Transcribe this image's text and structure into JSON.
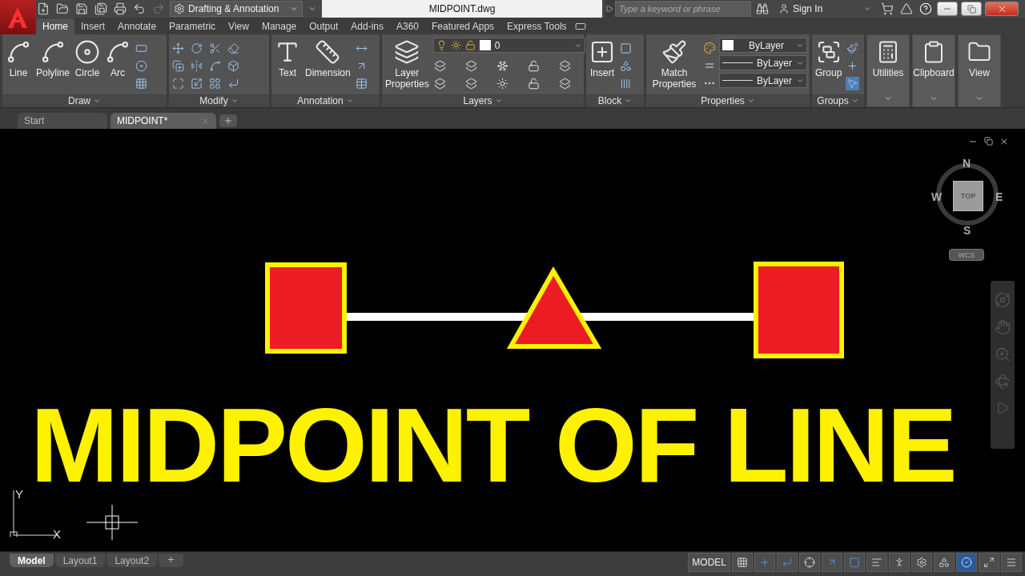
{
  "title_bar": {
    "workspace": "Drafting & Annotation",
    "file_title": "MIDPOINT.dwg",
    "search": {
      "placeholder": "Type a keyword or phrase"
    },
    "sign_in": "Sign In"
  },
  "ribbon_tabs": [
    {
      "label": "Home",
      "selected": true
    },
    {
      "label": "Insert",
      "selected": false
    },
    {
      "label": "Annotate",
      "selected": false
    },
    {
      "label": "Parametric",
      "selected": false
    },
    {
      "label": "View",
      "selected": false
    },
    {
      "label": "Manage",
      "selected": false
    },
    {
      "label": "Output",
      "selected": false
    },
    {
      "label": "Add-ins",
      "selected": false
    },
    {
      "label": "A360",
      "selected": false
    },
    {
      "label": "Featured Apps",
      "selected": false
    },
    {
      "label": "Express Tools",
      "selected": false
    }
  ],
  "panels": [
    {
      "kind": "tools",
      "title": "Draw",
      "tools": [
        "Line",
        "Polyline",
        "Circle",
        "Arc"
      ]
    },
    {
      "kind": "tools",
      "title": "Modify"
    },
    {
      "kind": "tools",
      "title": "Annotation",
      "tools": [
        "Text",
        "Dimension"
      ]
    },
    {
      "kind": "layers",
      "title": "Layers",
      "tools": [
        "Layer Properties"
      ],
      "layer": "0"
    },
    {
      "kind": "tools",
      "title": "Block",
      "tools": [
        "Insert"
      ]
    },
    {
      "kind": "properties",
      "title": "Properties",
      "tools": [
        "Match Properties"
      ],
      "dropdowns": [
        "ByLayer",
        "ByLayer",
        "ByLayer"
      ]
    },
    {
      "kind": "tools",
      "title": "Groups",
      "tools": [
        "Group"
      ]
    },
    {
      "kind": "collapsed",
      "title": "Utilities"
    },
    {
      "kind": "collapsed",
      "title": "Clipboard"
    },
    {
      "kind": "collapsed",
      "title": "View"
    }
  ],
  "file_tabs": [
    {
      "label": "Start",
      "selected": false
    },
    {
      "label": "MIDPOINT*",
      "selected": true
    }
  ],
  "viewcube": {
    "face": "TOP",
    "north": "N",
    "south": "S",
    "east": "E",
    "west": "W",
    "ucs_menu": "WCS"
  },
  "ucs_icon": {
    "x": "X",
    "y": "Y"
  },
  "drawing": {
    "caption": "MIDPOINT OF LINE"
  },
  "layout_tabs": [
    {
      "label": "Model",
      "selected": true
    },
    {
      "label": "Layout1",
      "selected": false
    },
    {
      "label": "Layout2",
      "selected": false
    }
  ],
  "status_bar": {
    "space": "MODEL"
  }
}
